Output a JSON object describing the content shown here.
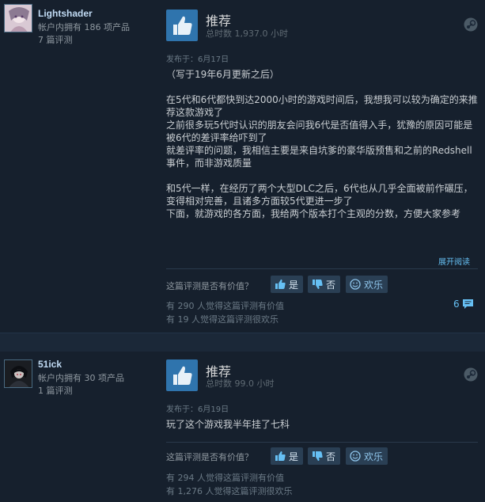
{
  "reviews": [
    {
      "username": "Lightshader",
      "products_owned": "帐户内拥有 186 项产品",
      "review_count": "7 篇评测",
      "recommendation": "推荐",
      "hours": "总时数 1,937.0 小时",
      "posted": "发布于：6月17日",
      "body": [
        "（写于19年6月更新之后）",
        "在5代和6代都快到达2000小时的游戏时间后，我想我可以较为确定的来推荐这款游戏了",
        "之前很多玩5代时认识的朋友会问我6代是否值得入手，犹豫的原因可能是被6代的差评率给吓到了",
        "就差评率的问题，我相信主要是来自坑爹的豪华版预售和之前的Redshell事件，而非游戏质量",
        "和5代一样，在经历了两个大型DLC之后，6代也从几乎全面被前作碾压，变得相对完善，且诸多方面较5代更进一步了",
        "下面，就游戏的各方面，我给两个版本打个主观的分数，方便大家参考"
      ],
      "read_more": "展开阅读",
      "helpful_question": "这篇评测是否有价值？",
      "btn_yes": "是",
      "btn_no": "否",
      "btn_funny": "欢乐",
      "helpful_count": "有 290 人觉得这篇评测有价值",
      "funny_count": "有 19 人觉得这篇评测很欢乐",
      "comment_count": "6"
    },
    {
      "username": "51ick",
      "products_owned": "帐户内拥有 30 项产品",
      "review_count": "1 篇评测",
      "recommendation": "推荐",
      "hours": "总时数 99.0 小时",
      "posted": "发布于：6月19日",
      "body": [
        "玩了这个游戏我半年挂了七科"
      ],
      "helpful_question": "这篇评测是否有价值？",
      "btn_yes": "是",
      "btn_no": "否",
      "btn_funny": "欢乐",
      "helpful_count": "有 294 人觉得这篇评测有价值",
      "funny_count": "有 1,276 人觉得这篇评测很欢乐"
    }
  ],
  "icons": {
    "thumb": "thumbs-up-icon",
    "steam": "steam-logo-icon",
    "comment": "comment-icon"
  },
  "colors": {
    "accent": "#66c0f4",
    "thumb_bg": "#2f74ad",
    "panel_bg": "#16202d"
  }
}
